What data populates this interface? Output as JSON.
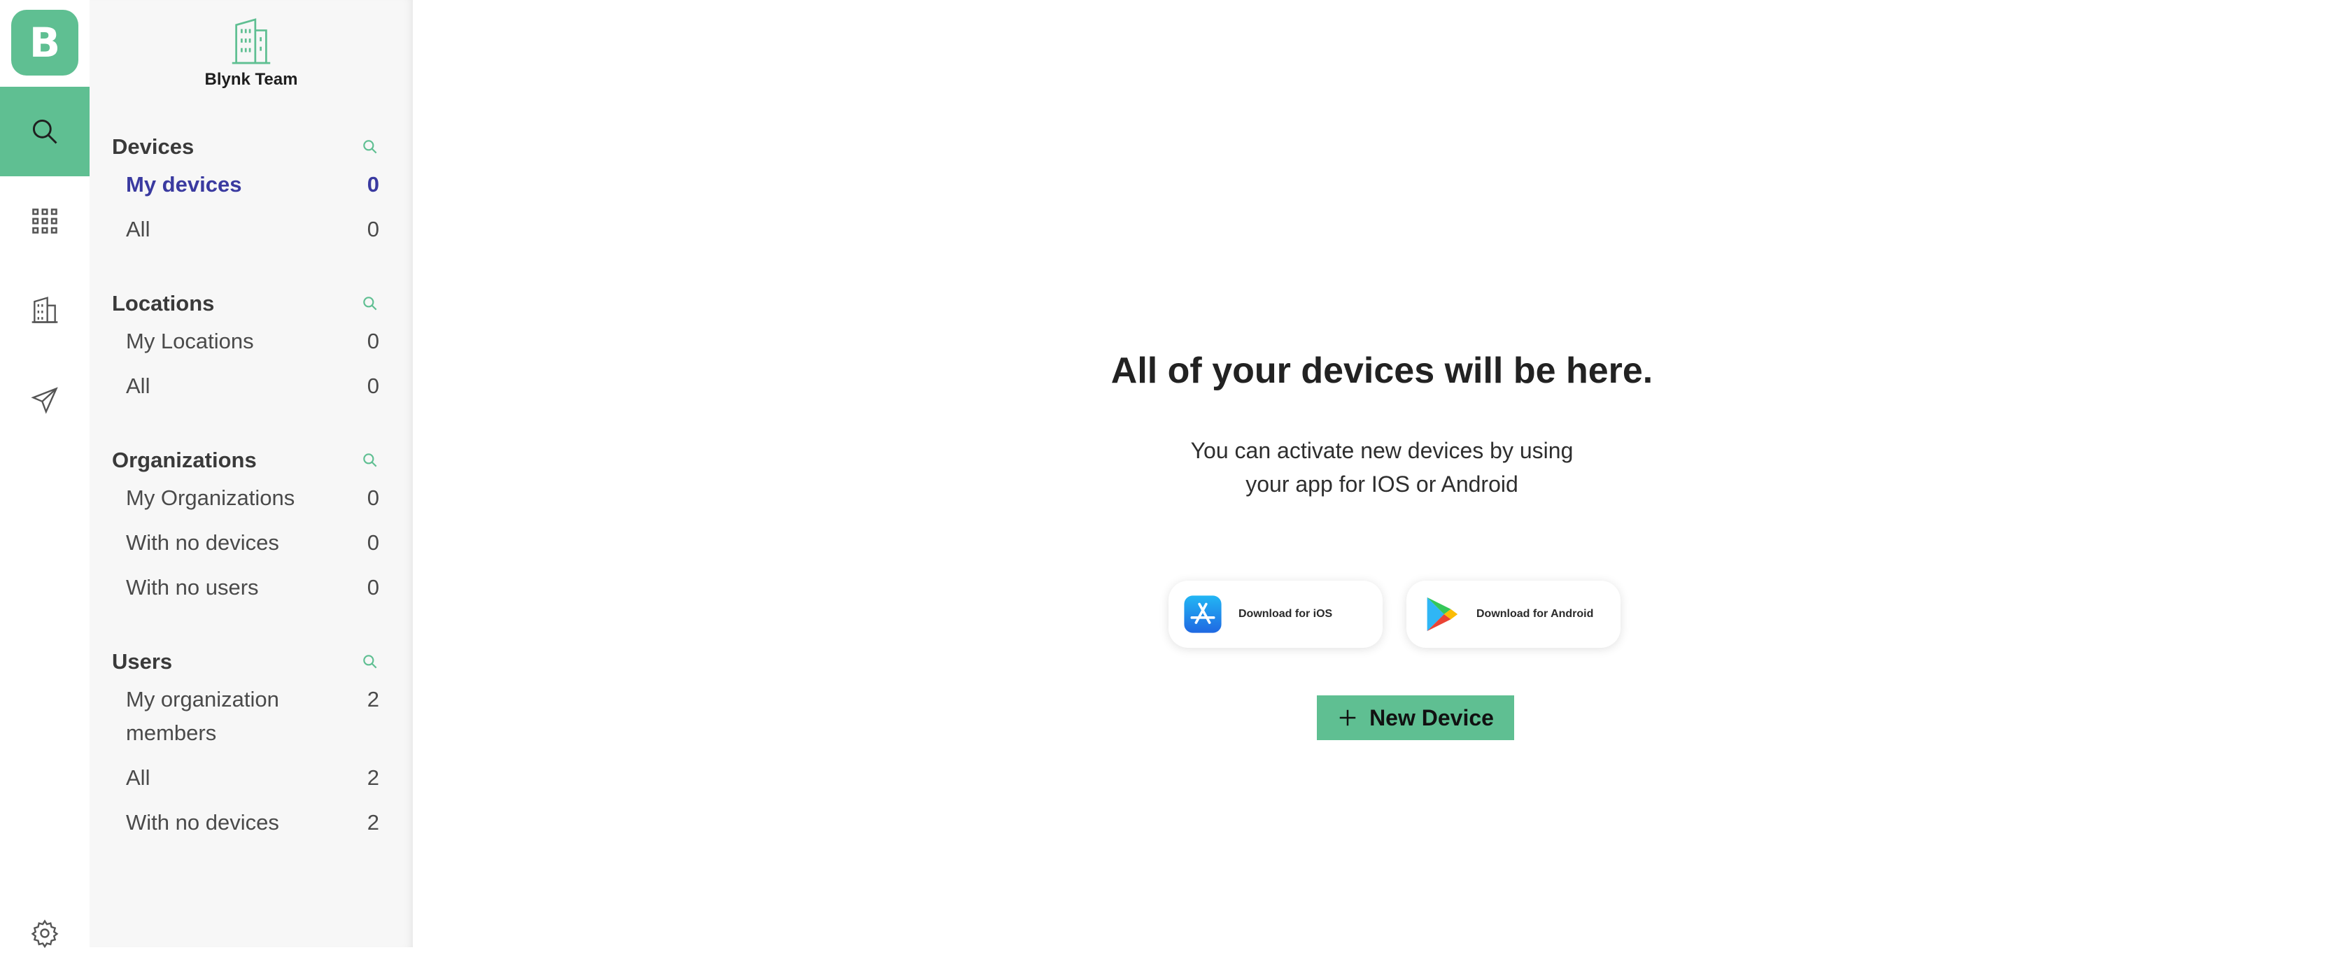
{
  "rail": {
    "logo_letter": "B",
    "items": [
      {
        "icon": "search-icon",
        "active": true
      },
      {
        "icon": "apps-grid-icon",
        "active": false
      },
      {
        "icon": "building-icon",
        "active": false
      },
      {
        "icon": "send-icon",
        "active": false
      },
      {
        "icon": "gear-icon",
        "active": false
      }
    ]
  },
  "sidebar": {
    "org_name": "Blynk Team",
    "org_icon": "building-icon",
    "sections": [
      {
        "title": "Devices",
        "items": [
          {
            "label": "My devices",
            "count": "0",
            "active": true
          },
          {
            "label": "All",
            "count": "0"
          }
        ]
      },
      {
        "title": "Locations",
        "items": [
          {
            "label": "My Locations",
            "count": "0"
          },
          {
            "label": "All",
            "count": "0"
          }
        ]
      },
      {
        "title": "Organizations",
        "items": [
          {
            "label": "My Organizations",
            "count": "0"
          },
          {
            "label": "With no devices",
            "count": "0"
          },
          {
            "label": "With no users",
            "count": "0"
          }
        ]
      },
      {
        "title": "Users",
        "items": [
          {
            "label": "My organization members",
            "count": "2"
          },
          {
            "label": "All",
            "count": "2"
          },
          {
            "label": "With no devices",
            "count": "2"
          }
        ]
      }
    ]
  },
  "main": {
    "headline": "All of your devices will be here.",
    "subtext_line1": "You can activate new devices by using",
    "subtext_line2": "your app for IOS or Android",
    "ios_button": "Download for iOS",
    "android_button": "Download for Android",
    "new_device_button": "New Device"
  },
  "colors": {
    "accent": "#5fbf92",
    "active_text": "#3a3aa0",
    "sidebar_bg": "#f7f7f7"
  }
}
